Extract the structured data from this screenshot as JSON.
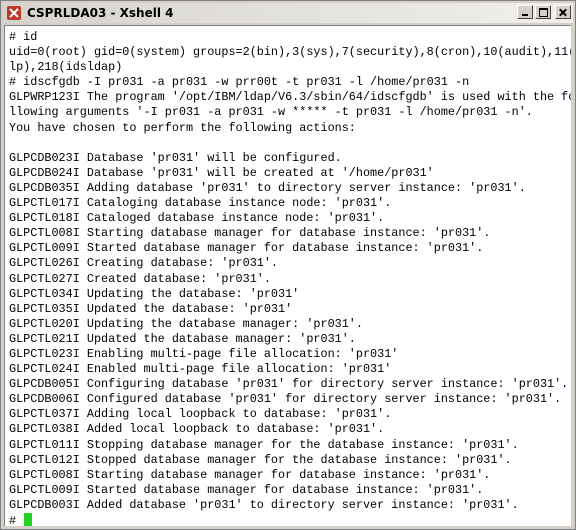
{
  "window": {
    "title": "CSPRLDA03 - Xshell 4"
  },
  "terminal": {
    "lines": [
      "# id",
      "uid=0(root) gid=0(system) groups=2(bin),3(sys),7(security),8(cron),10(audit),11(",
      "lp),218(idsldap)",
      "# idscfgdb -I pr031 -a pr031 -w prr00t -t pr031 -l /home/pr031 -n",
      "GLPWRP123I The program '/opt/IBM/ldap/V6.3/sbin/64/idscfgdb' is used with the fo",
      "llowing arguments '-I pr031 -a pr031 -w ***** -t pr031 -l /home/pr031 -n'.",
      "You have chosen to perform the following actions:",
      "",
      "GLPCDB023I Database 'pr031' will be configured.",
      "GLPCDB024I Database 'pr031' will be created at '/home/pr031'",
      "GLPCDB035I Adding database 'pr031' to directory server instance: 'pr031'.",
      "GLPCTL017I Cataloging database instance node: 'pr031'.",
      "GLPCTL018I Cataloged database instance node: 'pr031'.",
      "GLPCTL008I Starting database manager for database instance: 'pr031'.",
      "GLPCTL009I Started database manager for database instance: 'pr031'.",
      "GLPCTL026I Creating database: 'pr031'.",
      "GLPCTL027I Created database: 'pr031'.",
      "GLPCTL034I Updating the database: 'pr031'",
      "GLPCTL035I Updated the database: 'pr031'",
      "GLPCTL020I Updating the database manager: 'pr031'.",
      "GLPCTL021I Updated the database manager: 'pr031'.",
      "GLPCTL023I Enabling multi-page file allocation: 'pr031'",
      "GLPCTL024I Enabled multi-page file allocation: 'pr031'",
      "GLPCDB005I Configuring database 'pr031' for directory server instance: 'pr031'.",
      "GLPCDB006I Configured database 'pr031' for directory server instance: 'pr031'.",
      "GLPCTL037I Adding local loopback to database: 'pr031'.",
      "GLPCTL038I Added local loopback to database: 'pr031'.",
      "GLPCTL011I Stopping database manager for the database instance: 'pr031'.",
      "GLPCTL012I Stopped database manager for the database instance: 'pr031'.",
      "GLPCTL008I Starting database manager for database instance: 'pr031'.",
      "GLPCTL009I Started database manager for database instance: 'pr031'.",
      "GLPCDB003I Added database 'pr031' to directory server instance: 'pr031'."
    ],
    "prompt": "# "
  },
  "colors": {
    "cursor": "#22d322",
    "background": "#ffffff",
    "text": "#000000"
  },
  "icons": {
    "app": "xshell-icon",
    "minimize": "minimize-icon",
    "maximize": "maximize-icon",
    "close": "close-icon"
  }
}
